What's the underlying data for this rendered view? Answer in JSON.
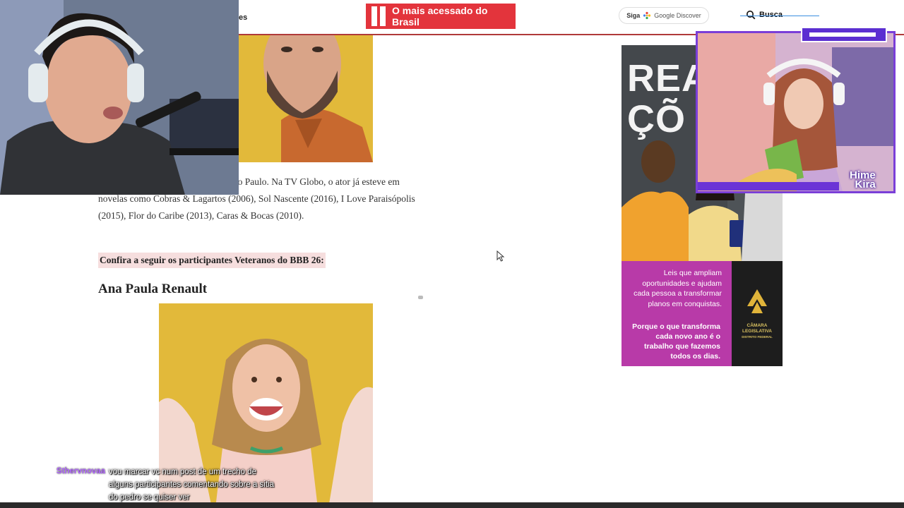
{
  "header": {
    "nav_fragment": "es",
    "brand_banner": "O mais acessado do Brasil",
    "discover": {
      "siga": "Siga",
      "google_discover": "Google Discover"
    },
    "search_label": "Busca"
  },
  "article": {
    "paragraph": "tural de São Bernardo do Campo, São Paulo. Na TV Globo, o ator já esteve em novelas como Cobras & Lagartos (2006), Sol Nascente (2016), I Love Paraisópolis (2015), Flor do Caribe (2013), Caras & Bocas (2010).",
    "highlight": "Confira a seguir os participantes Veteranos do BBB 26:",
    "section_title": "Ana Paula Renault"
  },
  "ad": {
    "headline_line1": "REA",
    "headline_line2": "ÇÕ",
    "text1": "Leis que ampliam oportunidades e ajudam cada pessoa a transformar planos em conquistas.",
    "text2": "Porque o que transforma cada novo ano é o trabalho que fazemos todos os dias.",
    "logo_text": "CÂMARA LEGISLATIVA",
    "logo_subtext": "DISTRITO FEDERAL",
    "colors": {
      "panel": "#b83aa8",
      "logo_box": "#1d1d1d"
    }
  },
  "guest_cam": {
    "label_line1": "Hime",
    "label_line2": "Kira"
  },
  "chat": {
    "username": "Sthervnovaa",
    "message": "vou marcar vc num post de um trecho de alguns participantes comentando sobre a sitia do pedro se quiser ver"
  },
  "colors": {
    "brand": "#e3343c",
    "header_line": "#b03a3a",
    "highlight": "#f6dede",
    "chat_user": "#b267ff",
    "cam_border": "#7a3ed8"
  }
}
